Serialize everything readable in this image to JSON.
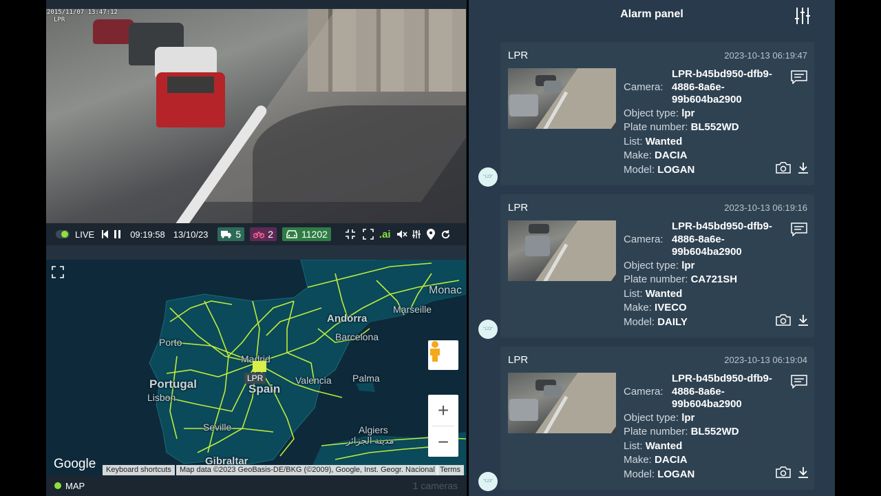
{
  "video": {
    "timestamp": "2015/11/07  13:47:12",
    "label": "LPR"
  },
  "controls": {
    "live": "LIVE",
    "time": "09:19:58",
    "date": "13/10/23",
    "truck_count": "5",
    "bike_count": "2",
    "car_count": "11202",
    "ai_label": ".ai",
    "colors": {
      "truck": "#2d6b58",
      "bike": "#5c2a55",
      "car": "#2f7d45",
      "accent": "#8ee03a"
    }
  },
  "map": {
    "labels": {
      "monaco": "Monac",
      "marseille": "Marseille",
      "andorra": "Andorra",
      "barcelona": "Barcelona",
      "porto": "Porto",
      "madrid": "Madrid",
      "portugal": "Portugal",
      "lisbon": "Lisbon",
      "spain": "Spain",
      "valencia": "Valencia",
      "palma": "Palma",
      "seville": "Seville",
      "algiers": "Algiers",
      "algiers_ar": "مدينة الجزائر",
      "gibraltar": "Gibraltar"
    },
    "marker_label": "LPR",
    "google": "Google",
    "keyboard": "Keyboard shortcuts",
    "map_data": "Map data ©2023 GeoBasis-DE/BKG (©2009), Google, Inst. Geogr. Nacional",
    "terms": "Terms",
    "zoom_in": "+",
    "zoom_out": "−"
  },
  "footer": {
    "label": "MAP",
    "cameras": "1 cameras"
  },
  "panel": {
    "title": "Alarm panel",
    "field_labels": {
      "camera": "Camera:",
      "object_type": "Object type:",
      "plate": "Plate number:",
      "list": "List:",
      "make": "Make:",
      "model": "Model:"
    },
    "avatar_text": "\"123\"",
    "alarms": [
      {
        "type": "LPR",
        "time": "2023-10-13 06:19:47",
        "camera_line1": "LPR-b45bd950-dfb9-",
        "camera_line2": "4886-8a6e-",
        "camera_line3": "99b604ba2900",
        "object_type": "lpr",
        "plate": "BL552WD",
        "list": "Wanted",
        "make": "DACIA",
        "model": "LOGAN"
      },
      {
        "type": "LPR",
        "time": "2023-10-13 06:19:16",
        "camera_line1": "LPR-b45bd950-dfb9-",
        "camera_line2": "4886-8a6e-",
        "camera_line3": "99b604ba2900",
        "object_type": "lpr",
        "plate": "CA721SH",
        "list": "Wanted",
        "make": "IVECO",
        "model": "DAILY"
      },
      {
        "type": "LPR",
        "time": "2023-10-13 06:19:04",
        "camera_line1": "LPR-b45bd950-dfb9-",
        "camera_line2": "4886-8a6e-",
        "camera_line3": "99b604ba2900",
        "object_type": "lpr",
        "plate": "BL552WD",
        "list": "Wanted",
        "make": "DACIA",
        "model": "LOGAN"
      }
    ]
  }
}
